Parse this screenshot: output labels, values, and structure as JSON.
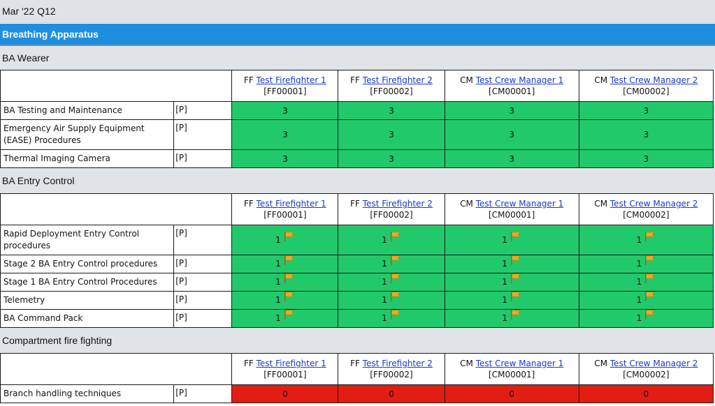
{
  "period": "Mar '22 Q12",
  "category": "Breathing Apparatus",
  "colors": {
    "pass": "#22c96a",
    "fail": "#e21e14",
    "category_bar": "#1e8fe0",
    "flag": "#f5a623"
  },
  "people": [
    {
      "rank": "FF",
      "name": "Test Firefighter 1",
      "id": "[FF00001]"
    },
    {
      "rank": "FF",
      "name": "Test Firefighter 2",
      "id": "[FF00002]"
    },
    {
      "rank": "CM",
      "name": "Test Crew Manager 1",
      "id": "[CM00001]"
    },
    {
      "rank": "CM",
      "name": "Test Crew Manager 2",
      "id": "[CM00002]"
    }
  ],
  "sections": [
    {
      "title": "BA Wearer",
      "rows": [
        {
          "label": "BA Testing and Maintenance",
          "type": "[P]",
          "values": [
            "3",
            "3",
            "3",
            "3"
          ],
          "status": "pass",
          "flag": false
        },
        {
          "label": "Emergency Air Supply Equipment (EASE) Procedures",
          "type": "[P]",
          "values": [
            "3",
            "3",
            "3",
            "3"
          ],
          "status": "pass",
          "flag": false
        },
        {
          "label": "Thermal Imaging Camera",
          "type": "[P]",
          "values": [
            "3",
            "3",
            "3",
            "3"
          ],
          "status": "pass",
          "flag": false
        }
      ]
    },
    {
      "title": "BA Entry Control",
      "rows": [
        {
          "label": "Rapid Deployment Entry Control procedures",
          "type": "[P]",
          "values": [
            "1",
            "1",
            "1",
            "1"
          ],
          "status": "pass",
          "flag": true
        },
        {
          "label": "Stage 2 BA Entry Control procedures",
          "type": "[P]",
          "values": [
            "1",
            "1",
            "1",
            "1"
          ],
          "status": "pass",
          "flag": true
        },
        {
          "label": "Stage 1 BA Entry Control Procedures",
          "type": "[P]",
          "values": [
            "1",
            "1",
            "1",
            "1"
          ],
          "status": "pass",
          "flag": true
        },
        {
          "label": "Telemetry",
          "type": "[P]",
          "values": [
            "1",
            "1",
            "1",
            "1"
          ],
          "status": "pass",
          "flag": true
        },
        {
          "label": "BA Command Pack",
          "type": "[P]",
          "values": [
            "1",
            "1",
            "1",
            "1"
          ],
          "status": "pass",
          "flag": true
        }
      ]
    },
    {
      "title": "Compartment fire fighting",
      "rows": [
        {
          "label": "Branch handling techniques",
          "type": "[P]",
          "values": [
            "0",
            "0",
            "0",
            "0"
          ],
          "status": "fail",
          "flag": false
        }
      ]
    }
  ]
}
